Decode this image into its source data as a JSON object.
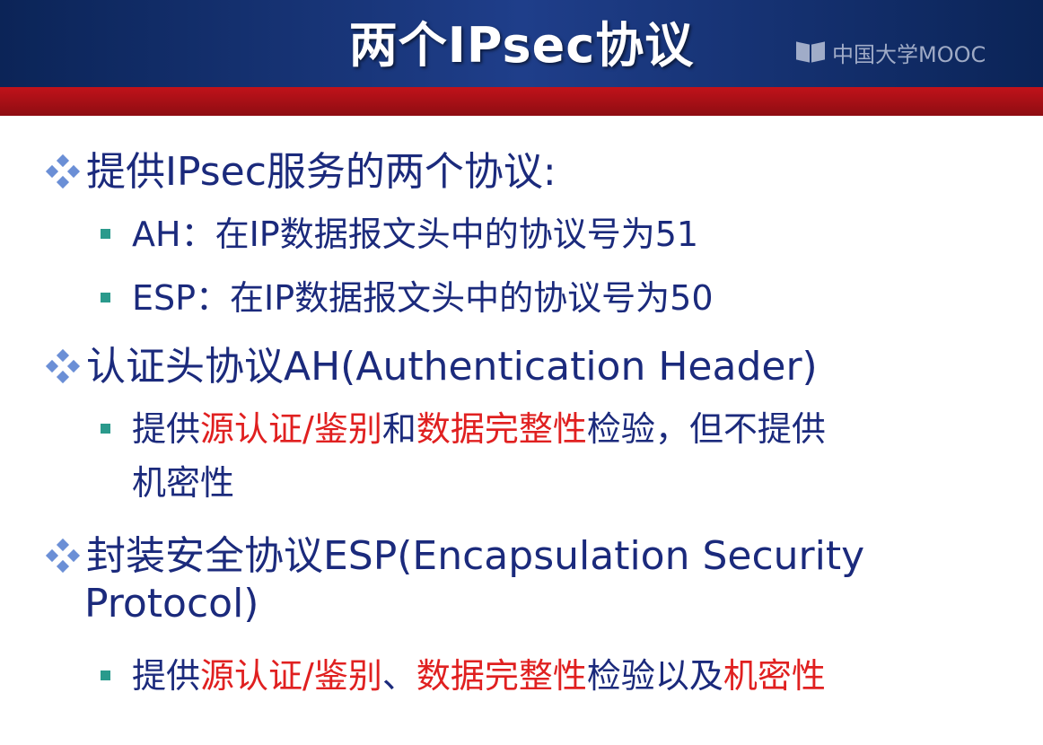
{
  "header": {
    "title": "两个IPsec协议",
    "watermark": "中国大学MOOC"
  },
  "bullets": [
    {
      "text": "提供IPsec服务的两个协议:",
      "sub": [
        {
          "parts": [
            "AH：在IP数据报文头中的协议号为51"
          ]
        },
        {
          "parts": [
            "ESP：在IP数据报文头中的协议号为50"
          ]
        }
      ]
    },
    {
      "text": "认证头协议AH(Authentication Header)",
      "sub": [
        {
          "parts": [
            "提供",
            "源认证/鉴别",
            "和",
            "数据完整性",
            "检验，但不提供"
          ],
          "cont": "机密性"
        }
      ]
    },
    {
      "text": "封装安全协议ESP(Encapsulation Security",
      "text_cont": "Protocol)",
      "sub": [
        {
          "parts": [
            "提供",
            "源认证/鉴别",
            "、",
            "数据完整性",
            "检验以及",
            "机密性"
          ]
        }
      ]
    }
  ],
  "colors": {
    "text": "#1b2a7c",
    "highlight": "#e02020",
    "header": "#1f3e8a",
    "bar": "#c0121a",
    "bullet": "#2a9a8c"
  },
  "icons": {
    "main_bullet": "diamond-cluster-icon",
    "sub_bullet": "square-bullet-icon"
  }
}
